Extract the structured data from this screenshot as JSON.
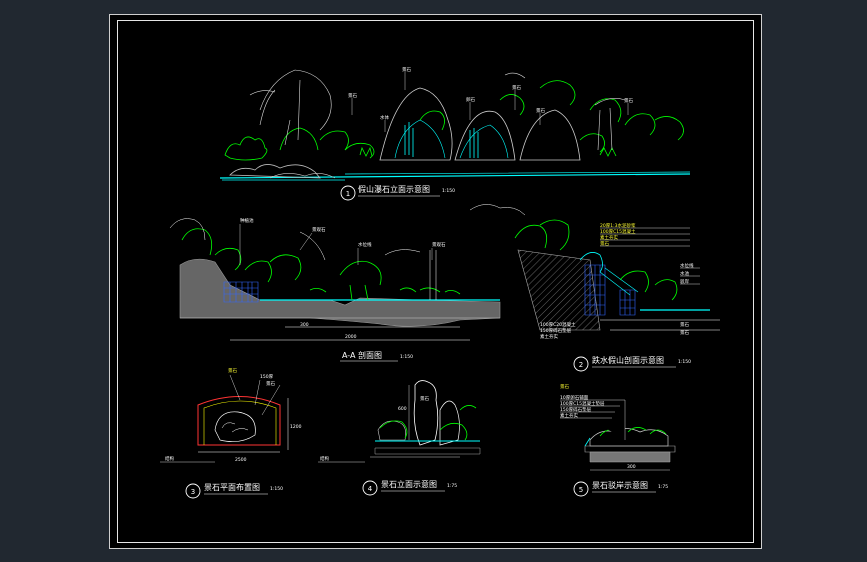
{
  "drawing": {
    "title1": "假山瀑石立面示意图",
    "scale1": "1:150",
    "num1": "1",
    "title2": "跌水假山剖面示意图",
    "scale2": "1:150",
    "num2": "2",
    "title3": "景石平面布置图",
    "scale3": "1:150",
    "num3": "3",
    "title4": "景石立面示意图",
    "scale4": "1:75",
    "num4": "4",
    "title5": "景石驳岸示意图",
    "scale5": "1:75",
    "num5": "5",
    "titleAA": "A-A 剖面图",
    "scaleAA": "1:150"
  },
  "annotations": {
    "a1": "景石",
    "a2": "种植池",
    "a3": "景观石",
    "a4": "水位线",
    "a5": "景石",
    "a6": "水体",
    "a7": "卵石",
    "a8": "结构",
    "a9": "景石",
    "a10": "景观石",
    "a11": "水位线",
    "a12": "水池",
    "a13": "景石",
    "a14": "景石",
    "a15": "100厚C20混凝土",
    "a16": "150厚碎石垫层",
    "a17": "素土夯实",
    "a18": "景石",
    "a19": "驳岸",
    "a20": "景石",
    "a21": "20厚1:3水泥砂浆",
    "a22": "景石",
    "a23": "100厚C15混凝土",
    "a24": "素土夯实",
    "a25": "300",
    "a26": "2000",
    "a27": "2500",
    "a28": "1200",
    "a29": "600",
    "a30": "景石",
    "a31": "150厚",
    "a32": "景石",
    "a33": "10厚卵石铺面",
    "a34": "100厚C15混凝土垫层",
    "a35": "150厚碎石垫层",
    "a36": "素土夯实",
    "a37": "300"
  }
}
